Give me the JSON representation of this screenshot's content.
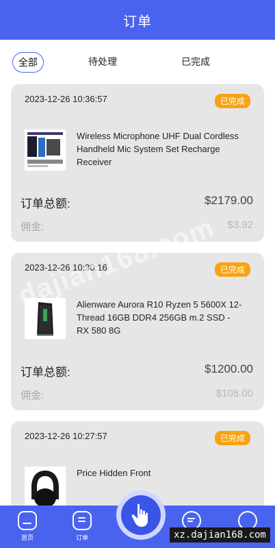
{
  "header": {
    "title": "订单"
  },
  "tabs": [
    {
      "label": "全部",
      "active": true
    },
    {
      "label": "待处理",
      "active": false
    },
    {
      "label": "已完成",
      "active": false
    }
  ],
  "orders": [
    {
      "time": "2023-12-26 10:36:57",
      "status": "已完成",
      "product": "Wireless Microphone UHF Dual Cordless Handheld Mic System Set Recharge Receiver",
      "total_label": "订单总额:",
      "total": "$2179.00",
      "commission_label": "佣金:",
      "commission": "$3.92"
    },
    {
      "time": "2023-12-26 10:30:16",
      "status": "已完成",
      "product": "Alienware Aurora R10 Ryzen 5 5600X 12-Thread 16GB DDR4 256GB m.2 SSD - RX 580 8G",
      "total_label": "订单总额:",
      "total": "$1200.00",
      "commission_label": "佣金:",
      "commission": "$108.00"
    },
    {
      "time": "2023-12-26 10:27:57",
      "status": "已完成",
      "product": "Price Hidden Front"
    }
  ],
  "tabbar": {
    "items": [
      {
        "label": "首页",
        "icon": "home-icon"
      },
      {
        "label": "订单",
        "icon": "order-icon"
      },
      {
        "label": "",
        "icon": "message-icon"
      },
      {
        "label": "",
        "icon": "profile-icon"
      }
    ],
    "center_icon": "hand-pointer-icon"
  },
  "overlay": {
    "watermark": "dajian168.com",
    "site_mark": "xz.dajian168.com"
  },
  "colors": {
    "primary": "#4a63ef",
    "badge": "#f7a315",
    "card": "#e6e6e6"
  }
}
